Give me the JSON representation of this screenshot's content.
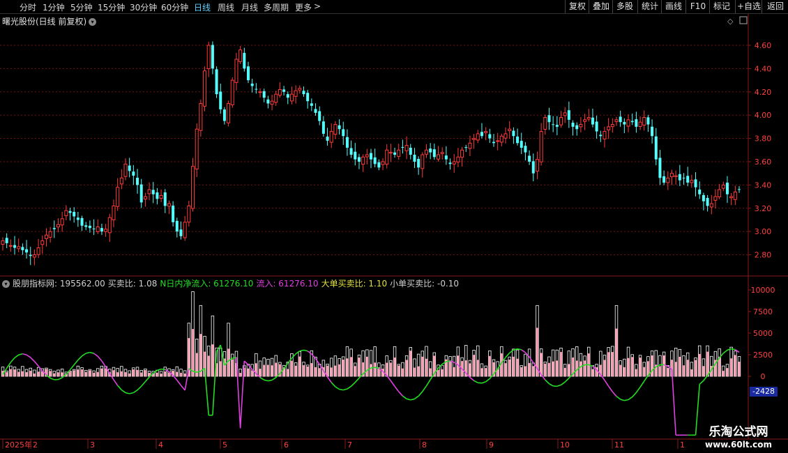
{
  "toolbar": {
    "periods": [
      "分时",
      "1分钟",
      "5分钟",
      "15分钟",
      "30分钟",
      "60分钟",
      "日线",
      "周线",
      "月线",
      "多周期",
      "更多"
    ],
    "active_period": "日线",
    "more_arrow": ">",
    "right_buttons": [
      "复权",
      "叠加",
      "多股",
      "统计",
      "画线",
      "F10",
      "标记",
      "+自选",
      "返回"
    ]
  },
  "stock": {
    "title": "曙光股份(日线 前复权)",
    "dropdown_icon": "chevron-down-icon"
  },
  "price_axis": {
    "ticks": [
      "4.60",
      "4.40",
      "4.20",
      "4.00",
      "3.80",
      "3.60",
      "3.40",
      "3.20",
      "3.00",
      "2.80"
    ]
  },
  "indicator": {
    "name": "股朋指标网",
    "value": ": 195562.00",
    "items": [
      {
        "text": "买卖比: 1.08",
        "color": "#d0d0d0"
      },
      {
        "text": "N日内净流入: 61276.10",
        "color": "#22dd22"
      },
      {
        "text": "流入: 61276.10",
        "color": "#e040e0"
      },
      {
        "text": "大单买卖比: 1.10",
        "color": "#e0e040"
      },
      {
        "text": "小单买卖比: -0.10",
        "color": "#d0d0d0"
      }
    ],
    "axis_ticks": [
      "10000",
      "7500",
      "5000",
      "2500",
      "0"
    ],
    "current_value": "-2428"
  },
  "date_axis": {
    "labels": [
      "2025年",
      "2",
      "3",
      "4",
      "5",
      "6",
      "7",
      "8",
      "9",
      "10",
      "11",
      "1"
    ]
  },
  "watermark": {
    "line1": "乐淘公式网",
    "line2": "www.60lt.com"
  },
  "colors": {
    "up": "#ff3b3b",
    "down": "#54ffff",
    "grid": "#7a1414",
    "green_line": "#22dd22",
    "magenta_line": "#e040e0",
    "bar_pink": "#ff9bb0",
    "bar_white": "#ffffff"
  },
  "chart_data": {
    "type": "candlestick",
    "ylim": [
      2.7,
      4.8
    ],
    "candles_close": [
      2.92,
      2.9,
      2.88,
      2.86,
      2.87,
      2.84,
      2.82,
      2.79,
      2.8,
      2.86,
      2.92,
      2.97,
      3.0,
      3.02,
      3.06,
      3.11,
      3.18,
      3.16,
      3.13,
      3.1,
      3.05,
      3.04,
      3.03,
      3.02,
      3.04,
      3.0,
      3.02,
      3.12,
      3.22,
      3.38,
      3.46,
      3.58,
      3.52,
      3.48,
      3.4,
      3.25,
      3.3,
      3.36,
      3.32,
      3.28,
      3.31,
      3.22,
      3.24,
      3.08,
      3.0,
      2.96,
      3.08,
      3.22,
      3.56,
      3.88,
      4.1,
      4.38,
      4.6,
      4.4,
      4.18,
      4.05,
      3.95,
      4.1,
      4.3,
      4.48,
      4.56,
      4.4,
      4.3,
      4.25,
      4.22,
      4.2,
      4.15,
      4.1,
      4.12,
      4.18,
      4.22,
      4.2,
      4.15,
      4.18,
      4.21,
      4.23,
      4.18,
      4.12,
      4.08,
      4.02,
      3.95,
      3.84,
      3.78,
      3.86,
      3.92,
      3.88,
      3.82,
      3.72,
      3.66,
      3.62,
      3.6,
      3.64,
      3.66,
      3.62,
      3.58,
      3.55,
      3.6,
      3.7,
      3.68,
      3.66,
      3.7,
      3.72,
      3.74,
      3.66,
      3.6,
      3.55,
      3.66,
      3.7,
      3.68,
      3.64,
      3.66,
      3.68,
      3.62,
      3.58,
      3.6,
      3.64,
      3.7,
      3.72,
      3.76,
      3.8,
      3.84,
      3.82,
      3.86,
      3.8,
      3.76,
      3.78,
      3.82,
      3.84,
      3.88,
      3.82,
      3.76,
      3.72,
      3.68,
      3.6,
      3.5,
      3.62,
      3.86,
      3.98,
      3.94,
      3.92,
      3.9,
      3.98,
      4.02,
      3.96,
      3.9,
      3.88,
      3.92,
      3.96,
      3.98,
      3.92,
      3.86,
      3.82,
      3.86,
      3.9,
      3.92,
      3.96,
      3.94,
      3.92,
      3.96,
      3.94,
      3.9,
      3.94,
      3.98,
      3.92,
      3.82,
      3.62,
      3.46,
      3.42,
      3.46,
      3.5,
      3.48,
      3.44,
      3.46,
      3.42,
      3.44,
      3.38,
      3.32,
      3.26,
      3.22,
      3.24,
      3.3,
      3.36,
      3.4,
      3.32,
      3.3,
      3.34,
      3.36
    ]
  }
}
